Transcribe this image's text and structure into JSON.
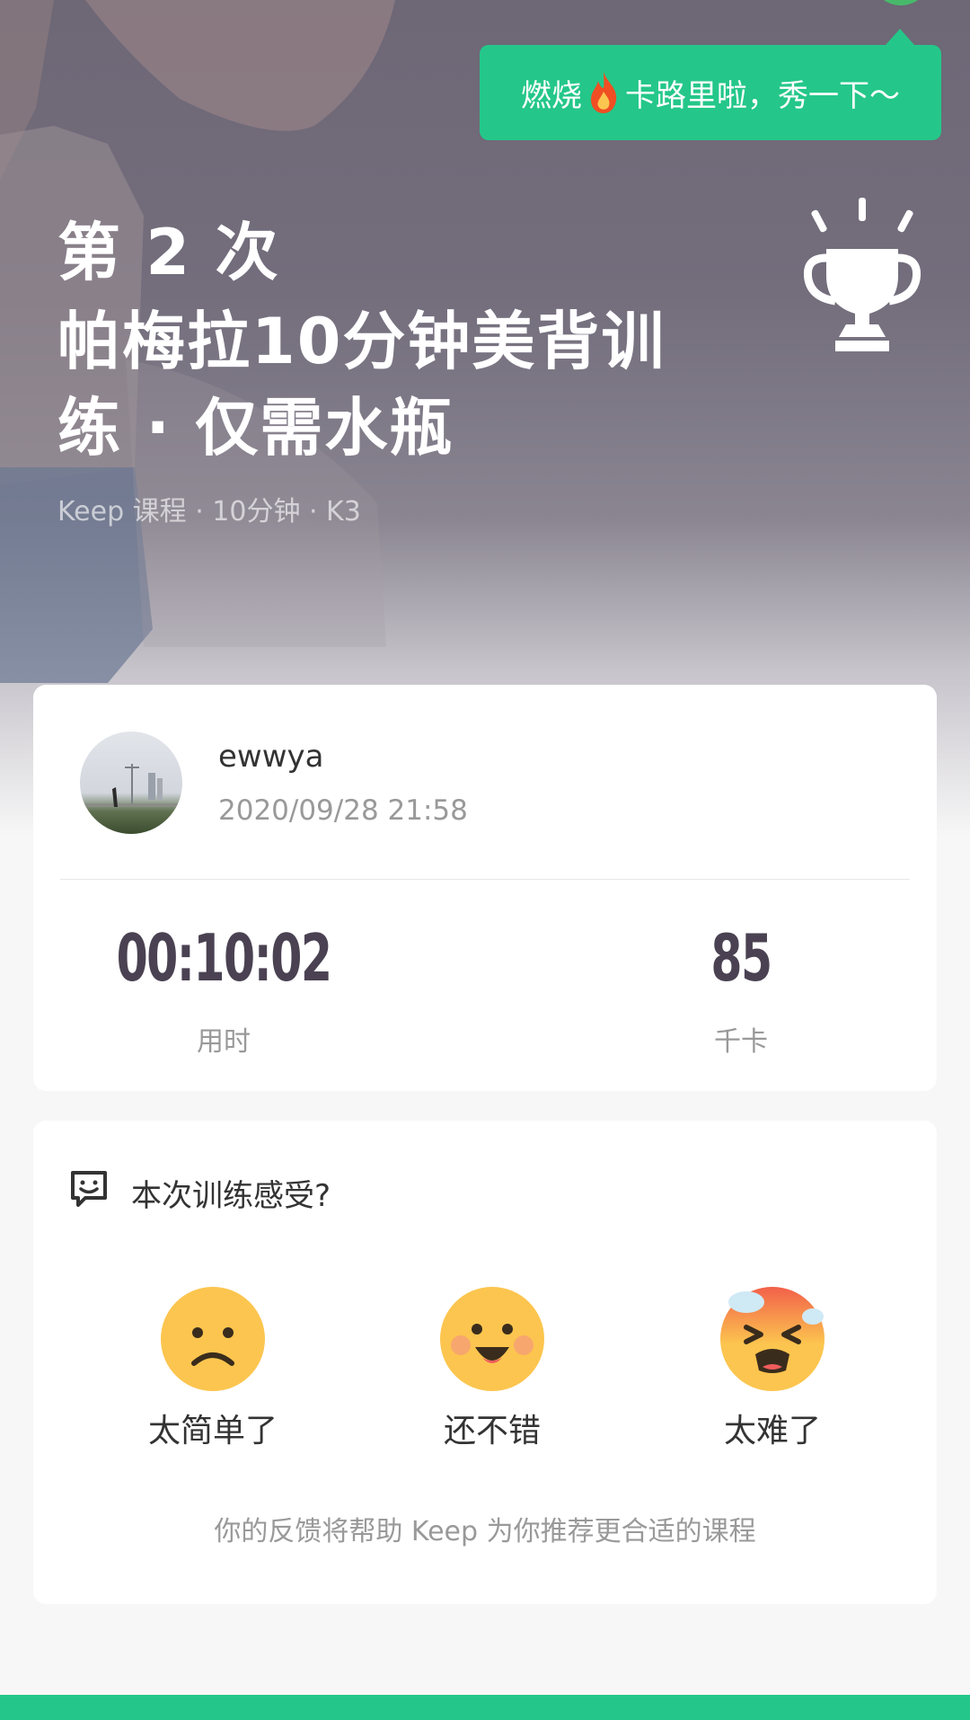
{
  "share_tip": {
    "text_before": "燃烧",
    "text_after": "卡路里啦，秀一下～"
  },
  "hero": {
    "count_label": "第 2 次",
    "course_title": "帕梅拉10分钟美背训练 · 仅需水瓶",
    "meta": "Keep 课程 · 10分钟 · K3"
  },
  "user": {
    "name": "ewwya",
    "datetime": "2020/09/28 21:58"
  },
  "stats": [
    {
      "value": "00:10:02",
      "label": "用时"
    },
    {
      "value": "85",
      "label": "千卡"
    }
  ],
  "feedback": {
    "title": "本次训练感受?",
    "options": [
      {
        "label": "太简单了",
        "icon": "frown-emoji-icon"
      },
      {
        "label": "还不错",
        "icon": "smile-emoji-icon"
      },
      {
        "label": "太难了",
        "icon": "exhausted-emoji-icon"
      }
    ],
    "note": "你的反馈将帮助 Keep 为你推荐更合适的课程"
  },
  "colors": {
    "accent": "#24c789",
    "stat_text": "#4a4252",
    "emoji_yellow": "#fcc54f"
  }
}
